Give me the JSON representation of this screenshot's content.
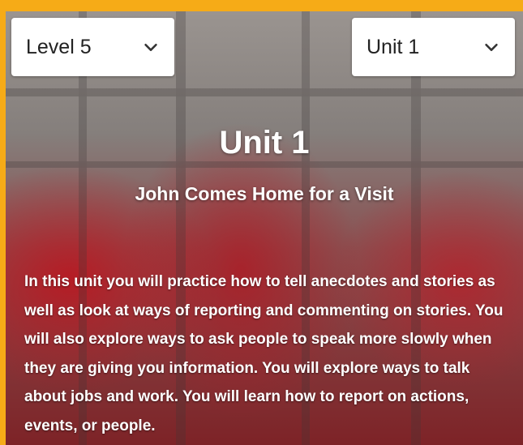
{
  "level_select": {
    "value": "Level 5",
    "icon": "chevron-down-icon"
  },
  "unit_select": {
    "value": "Unit 1",
    "icon": "chevron-down-icon"
  },
  "hero": {
    "title": "Unit 1",
    "subtitle": "John Comes Home for a Visit",
    "description": "In this unit you will practice how to tell anecdotes and stories as well as look at ways of reporting and commenting on stories. You will also explore ways to ask people to speak more slowly when they are giving you information. You will explore ways to talk about jobs and work. You will learn how to report on actions, events, or people."
  },
  "colors": {
    "border": "#f6ab17",
    "text": "#ffffff",
    "accent_red": "#be1e2d"
  }
}
